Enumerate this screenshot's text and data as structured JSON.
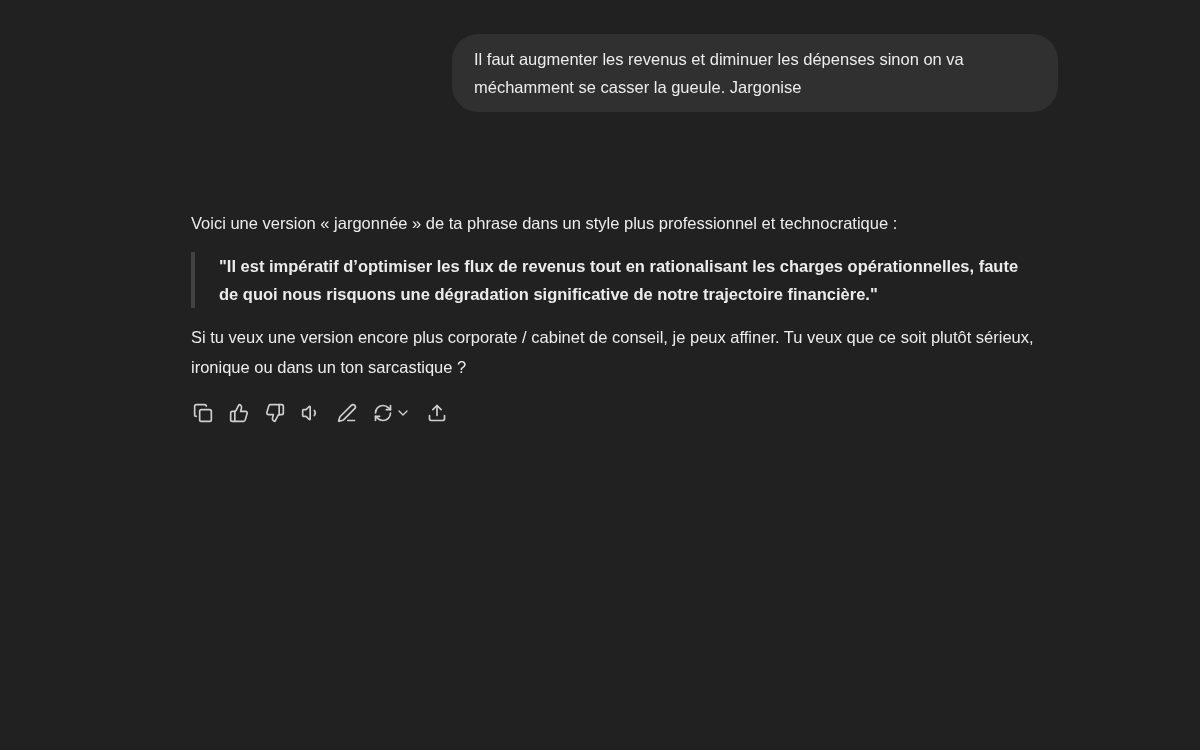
{
  "user_message": {
    "text": "Il faut augmenter les revenus et diminuer les dépenses sinon on va méchamment se casser la gueule. Jargonise"
  },
  "assistant_message": {
    "blocks": [
      {
        "kind": "paragraph",
        "text": "Voici une version « jargonnée » de ta phrase dans un style plus professionnel et technocratique :"
      },
      {
        "kind": "quote",
        "text": "\"Il est impératif d’optimiser les flux de revenus tout en rationalisant les charges opérationnelles, faute de quoi nous risquons une dégradation significative de notre trajectoire financière.\""
      },
      {
        "kind": "paragraph",
        "text": "Si tu veux une version encore plus corporate / cabinet de conseil, je peux affiner. Tu veux que ce soit plutôt sérieux, ironique ou dans un ton sarcastique ?"
      }
    ]
  }
}
